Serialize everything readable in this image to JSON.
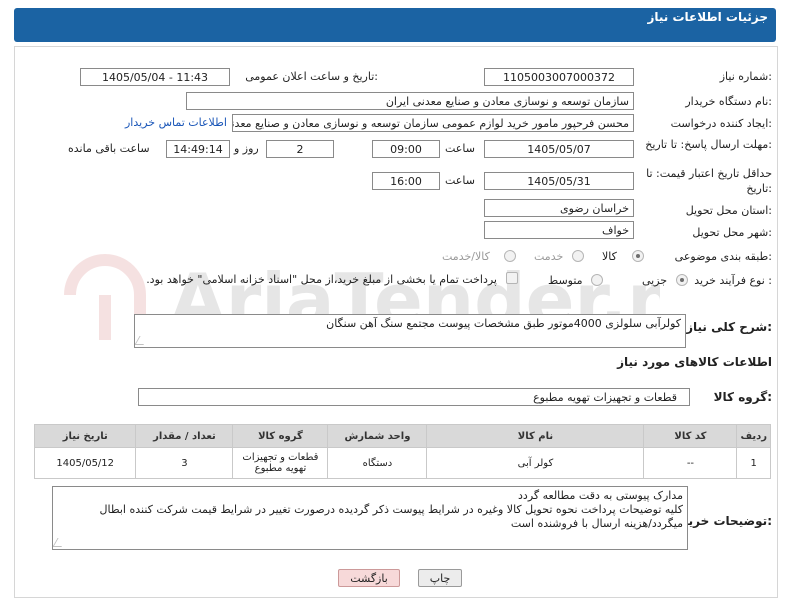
{
  "header": {
    "title": "جزئیات اطلاعات نیاز"
  },
  "form": {
    "need_number_label": "شماره نیاز:",
    "need_number": "1105003007000372",
    "announce_label": "تاریخ و ساعت اعلان عمومی:",
    "announce_value": "1405/05/04 - 11:43",
    "buyer_org_label": "نام دستگاه خریدار:",
    "buyer_org": "سازمان توسعه و نوسازی معادن و صنایع معدنی ایران",
    "creator_label": "ایجاد کننده درخواست:",
    "creator": "محسن فرحپور مامور خرید لوازم عمومی سازمان توسعه و نوسازی معادن و صنایع معدنی ایران",
    "contact_link": "اطلاعات تماس خریدار",
    "reply_deadline_label": "مهلت ارسال پاسخ: تا تاریخ:",
    "reply_date": "1405/05/07",
    "time_label": "ساعت",
    "reply_time": "09:00",
    "days_value": "2",
    "days_label": "روز و",
    "remaining_time": "14:49:14",
    "remaining_label": "ساعت باقی مانده",
    "price_validity_label": "حداقل تاریخ اعتبار قیمت: تا تاریخ:",
    "validity_date": "1405/05/31",
    "validity_time_label": "ساعت",
    "validity_time": "16:00",
    "province_label": "استان محل تحویل:",
    "province": "خراسان رضوی",
    "city_label": "شهر محل تحویل:",
    "city": "خواف",
    "category_label": "طبقه بندی موضوعی:",
    "category_options": [
      "کالا",
      "خدمت",
      "کالا/خدمت"
    ],
    "category_selected": "کالا",
    "process_label": "نوع فرآیند خرید :",
    "process_options": [
      "جزیی",
      "متوسط"
    ],
    "process_selected": "جزیی",
    "payment_note": "پرداخت تمام یا بخشی از مبلغ خرید،از محل \"اسناد خزانه اسلامی\" خواهد بود.",
    "description_label": "شرح کلی نیاز:",
    "description": "کولرآبی سلولزی 4000موتور طبق مشخصات پیوست مجتمع سنگ آهن سنگان",
    "goods_info_title": "اطلاعات کالاهای مورد نیاز",
    "goods_group_label": "گروه کالا:",
    "goods_group": "قطعات و تجهیزات تهویه مطبوع"
  },
  "table": {
    "headers": [
      "ردیف",
      "کد کالا",
      "نام کالا",
      "واحد شمارش",
      "گروه کالا",
      "تعداد / مقدار",
      "تاریخ نیاز"
    ],
    "rows": [
      [
        "1",
        "--",
        "کولر آبی",
        "دستگاه",
        "قطعات و تجهیزات تهویه مطبوع",
        "3",
        "1405/05/12"
      ]
    ]
  },
  "buyer_notes": {
    "label": "توضیحات خریدار:",
    "line1": "مدارک پیوستی به دقت مطالعه گردد",
    "line2": "کلیه توضیحات پرداخت نحوه تحویل کالا وغیره در شرایط پیوست ذکر گردیده درصورت تغییر در شرایط  قیمت شرکت کننده ابطال",
    "line3": "میگردد/هزینه ارسال با فروشنده است"
  },
  "buttons": {
    "print": "چاپ",
    "back": "بازگشت"
  },
  "watermark": {
    "text": "AriaTender.net"
  },
  "colors": {
    "header": "#1b63a3",
    "link": "#1a56b8",
    "back_button": "#f7d9d9"
  }
}
